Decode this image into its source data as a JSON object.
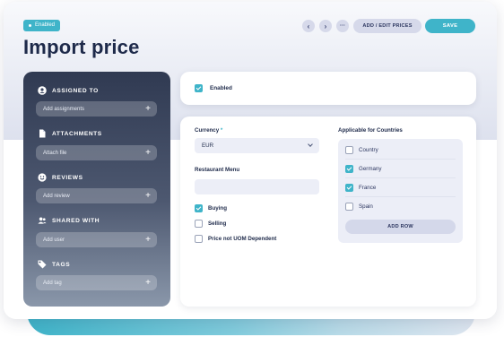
{
  "header": {
    "status_badge": "Enabled",
    "title": "Import price",
    "nav_prev_icon": "‹",
    "nav_next_icon": "›",
    "more_icon": "···",
    "add_edit_prices_label": "ADD / EDIT PRICES",
    "save_label": "SAVE"
  },
  "sidebar": {
    "sections": [
      {
        "title": "ASSIGNED TO",
        "icon": "user-icon",
        "input_placeholder": "Add assignments"
      },
      {
        "title": "ATTACHMENTS",
        "icon": "file-icon",
        "input_placeholder": "Attach file"
      },
      {
        "title": "REVIEWS",
        "icon": "smiley-icon",
        "input_placeholder": "Add review"
      },
      {
        "title": "SHARED WITH",
        "icon": "users-icon",
        "input_placeholder": "Add user"
      },
      {
        "title": "TAGS",
        "icon": "tag-icon",
        "input_placeholder": "Add tag"
      }
    ],
    "plus_symbol": "+"
  },
  "enabled_panel": {
    "label": "Enabled",
    "checked": true
  },
  "form": {
    "currency": {
      "label": "Currency",
      "required_mark": "*",
      "value": "EUR"
    },
    "restaurant_menu": {
      "label": "Restaurant Menu",
      "value": ""
    },
    "options": [
      {
        "label": "Buying",
        "checked": true
      },
      {
        "label": "Selling",
        "checked": false
      },
      {
        "label": "Price not UOM Dependent",
        "checked": false
      }
    ],
    "countries": {
      "label": "Applicable for Countries",
      "rows": [
        {
          "label": "Country",
          "checked": false
        },
        {
          "label": "Germany",
          "checked": true
        },
        {
          "label": "France",
          "checked": true
        },
        {
          "label": "Spain",
          "checked": false
        }
      ],
      "add_row_label": "ADD ROW"
    }
  },
  "colors": {
    "accent": "#3fb4c9",
    "title": "#1e2a4a",
    "sidebar_top": "#303a52",
    "field_bg": "#eceef7"
  }
}
